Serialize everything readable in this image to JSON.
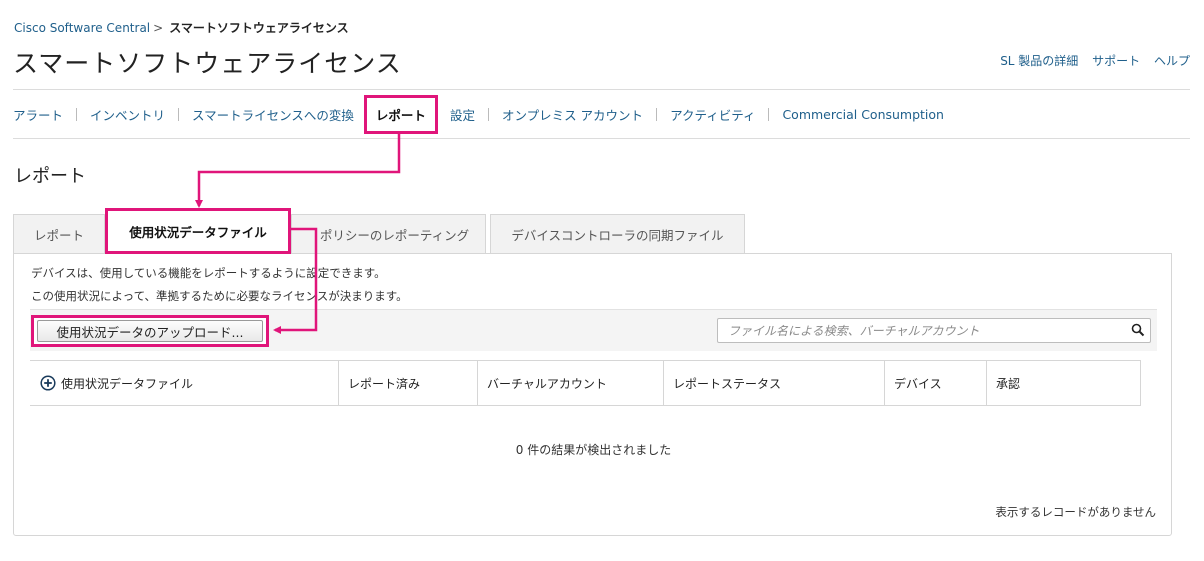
{
  "breadcrumb": {
    "parent": "Cisco Software Central",
    "separator": ">",
    "current": "スマートソフトウェアライセンス"
  },
  "page_title": "スマートソフトウェアライセンス",
  "header_links": [
    "SL 製品の詳細",
    "サポート",
    "ヘルプ"
  ],
  "nav": {
    "items": [
      "アラート",
      "インベントリ",
      "スマートライセンスへの変換",
      "レポート",
      "設定",
      "オンプレミス アカウント",
      "アクティビティ",
      "Commercial Consumption"
    ],
    "active": "レポート"
  },
  "section_title": "レポート",
  "tabs": [
    "レポート",
    "使用状況データファイル",
    "ポリシーのレポーティング",
    "デバイスコントローラの同期ファイル"
  ],
  "active_tab": "使用状況データファイル",
  "description": {
    "line1": "デバイスは、使用している機能をレポートするように設定できます。",
    "line2": "この使用状況によって、準拠するために必要なライセンスが決まります。"
  },
  "upload_button_label": "使用状況データのアップロード...",
  "search": {
    "placeholder": "ファイル名による検索、バーチャルアカウント"
  },
  "table": {
    "columns": [
      "使用状況データファイル",
      "レポート済み",
      "バーチャルアカウント",
      "レポートステータス",
      "デバイス",
      "承認"
    ],
    "empty_message": "0 件の結果が検出されました",
    "no_records_message": "表示するレコードがありません"
  },
  "colors": {
    "link": "#1f5f8b",
    "highlight": "#e0157a",
    "border": "#d6d6d6"
  }
}
